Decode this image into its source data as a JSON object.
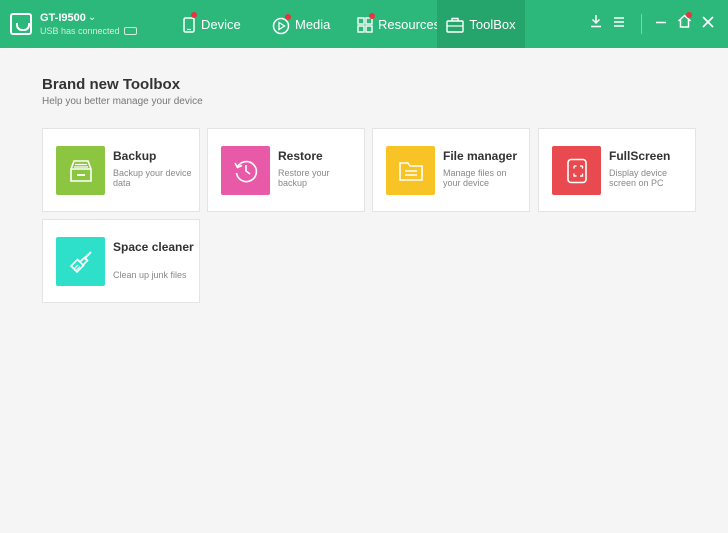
{
  "device": {
    "name": "GT-I9500",
    "status": "USB has connected"
  },
  "tabs": [
    {
      "label": "Device",
      "icon": "phone-icon"
    },
    {
      "label": "Media",
      "icon": "play-icon"
    },
    {
      "label": "Resources",
      "icon": "grid-icon"
    },
    {
      "label": "ToolBox",
      "icon": "toolbox-icon"
    }
  ],
  "page": {
    "title": "Brand new Toolbox",
    "subtitle": "Help you better manage your device"
  },
  "tools": [
    {
      "title": "Backup",
      "desc": "Backup your device data",
      "color": "#8cc53f"
    },
    {
      "title": "Restore",
      "desc": "Restore your backup",
      "color": "#e85aa8"
    },
    {
      "title": "File manager",
      "desc": "Manage files on your device",
      "color": "#f7c325"
    },
    {
      "title": "FullScreen",
      "desc": "Display device screen on PC",
      "color": "#e84a4f"
    },
    {
      "title": "Space cleaner",
      "desc": "Clean up junk files",
      "color": "#2ee0c9"
    }
  ],
  "colors": {
    "topbar": "#2cb87a",
    "active_tab": "#25a46b",
    "notify_dot": "#e8343a"
  }
}
